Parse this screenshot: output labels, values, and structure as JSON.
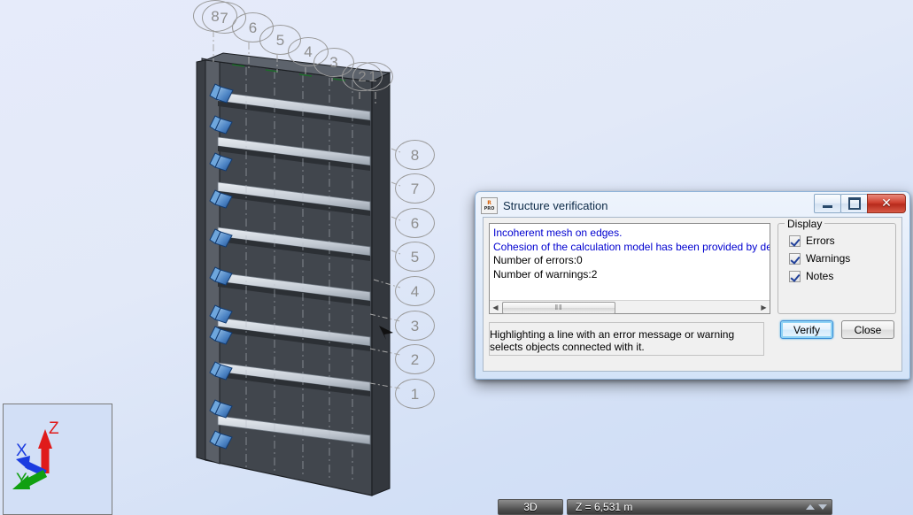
{
  "viewport": {
    "name": "3d-structure-view",
    "background_color": "#e2e9f8",
    "top_grid_labels": [
      "8",
      "7",
      "6",
      "5",
      "4",
      "3",
      "2",
      "1"
    ],
    "right_grid_labels": [
      "8",
      "7",
      "6",
      "5",
      "4",
      "3",
      "2",
      "1"
    ],
    "triad": {
      "z_label": "Z",
      "x_label": "X",
      "y_label": "Y",
      "z_color": "#e01b1b",
      "x_color": "#1b3ce0",
      "y_color": "#11a011"
    }
  },
  "statusbar": {
    "view_mode": "3D",
    "coordinate": "Z = 6,531 m"
  },
  "dialog": {
    "title": "Structure verification",
    "icon": "robot-pro-icon",
    "window_buttons": {
      "minimize": "minimize-icon",
      "maximize": "maximize-icon",
      "close": "close-icon"
    },
    "messages": [
      {
        "text": "Incoherent mesh on edges.",
        "severity": "warning"
      },
      {
        "text": "Cohesion of the calculation model has been provided by definition ",
        "severity": "warning"
      },
      {
        "text": "Number of errors:0",
        "severity": "info"
      },
      {
        "text": "Number of warnings:2",
        "severity": "info"
      }
    ],
    "scrollbar": {
      "left_arrow": "◀",
      "right_arrow": "▶",
      "grip": "‖‖"
    },
    "display_group": {
      "legend": "Display",
      "options": [
        {
          "label": "Errors",
          "checked": true
        },
        {
          "label": "Warnings",
          "checked": true
        },
        {
          "label": "Notes",
          "checked": true
        }
      ]
    },
    "buttons": {
      "verify": "Verify",
      "close": "Close"
    },
    "hint": "Highlighting a line with an error message or warning selects objects connected with it.",
    "accent_color": "#0000d0"
  }
}
